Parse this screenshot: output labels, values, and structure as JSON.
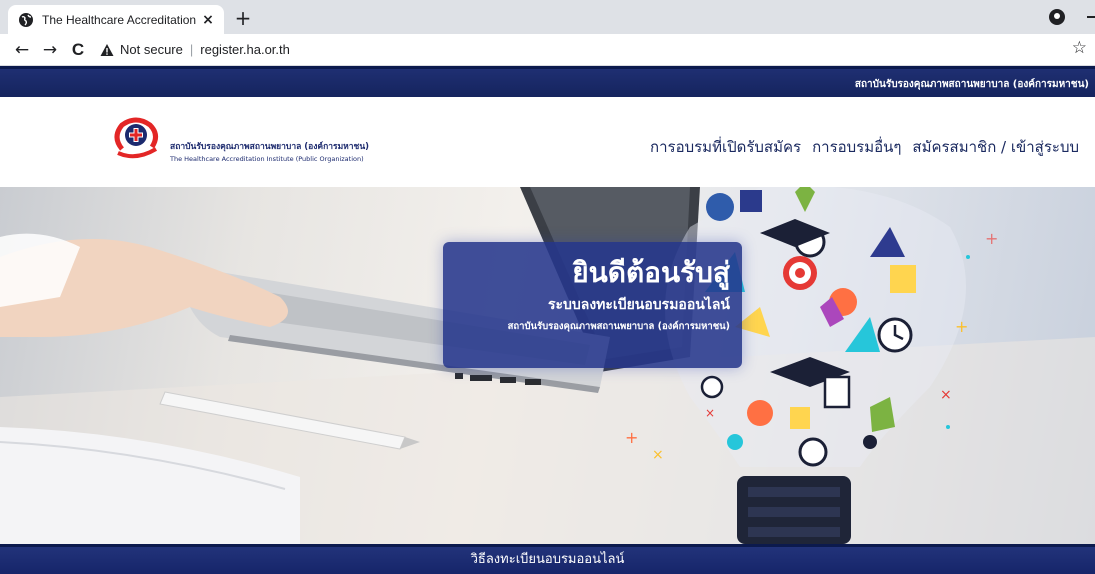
{
  "browser": {
    "tab_title": "The Healthcare Accreditation Insti",
    "tab_close": "×",
    "new_tab": "+",
    "nav_back": "←",
    "nav_forward": "→",
    "reload": "C",
    "security_label": "Not secure",
    "separator": "|",
    "url": "register.ha.or.th",
    "bookmark": "☆"
  },
  "top_strip": {
    "org_name": "สถาบันรับรองคุณภาพสถานพยาบาล (องค์การมหาชน)"
  },
  "header": {
    "logo_th": "สถาบันรับรองคุณภาพสถานพยาบาล (องค์การมหาชน)",
    "logo_en": "The Healthcare Accreditation Institute (Public Organization)",
    "menu": [
      {
        "label": "การอบรมที่เปิดรับสมัคร"
      },
      {
        "label": "การอบรมอื่นๆ"
      },
      {
        "label": "สมัครสมาชิก / เข้าสู่ระบบ"
      }
    ]
  },
  "hero": {
    "title": "ยินดีต้อนรับสู่",
    "subtitle": "ระบบลงทะเบียนอบรมออนไลน์",
    "org": "สถาบันรับรองคุณภาพสถานพยาบาล (องค์การมหาชน)"
  },
  "footer": {
    "label": "วิธีลงทะเบียนอบรมออนไลน์"
  },
  "colors": {
    "navy": "#1f2f72",
    "menu_text": "#1b2a60",
    "logo_red": "#e32626"
  }
}
